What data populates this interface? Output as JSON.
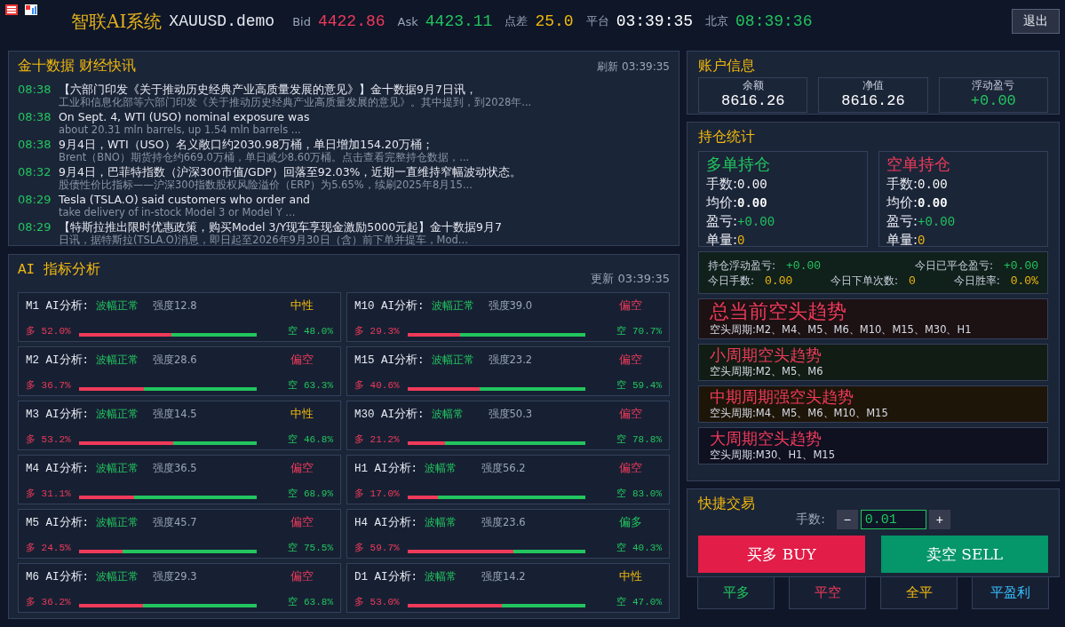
{
  "header": {
    "title": "智联AI系统",
    "symbol": "XAUUSD.demo",
    "quotes": [
      {
        "label": "Bid",
        "value": "4422.86",
        "kind": "red"
      },
      {
        "label": "Ask",
        "value": "4423.11",
        "kind": "green"
      },
      {
        "label": "点差",
        "value": "25.0",
        "kind": "gold"
      },
      {
        "label": "平台",
        "value": "03:39:35",
        "kind": "white"
      },
      {
        "label": "北京",
        "value": "08:39:36",
        "kind": "green"
      }
    ],
    "logout": "退出"
  },
  "news": {
    "title": "金十数据 财经快讯",
    "refreshed": "刷新 03:39:35",
    "items": [
      {
        "time": "08:38",
        "headline": "【六部门印发《关于推动历史经典产业高质量发展的意见》】金十数据9月7日讯，",
        "summary": "工业和信息化部等六部门印发《关于推动历史经典产业高质量发展的意见》。其中提到，到2028年..."
      },
      {
        "time": "08:38",
        "headline": "On Sept. 4, WTI (USO) nominal exposure was",
        "summary": "about 20.31 mln barrels, up 1.54 mln barrels ..."
      },
      {
        "time": "08:38",
        "headline": "9月4日，WTI（USO）名义敞口约2030.98万桶，单日增加154.20万桶；",
        "summary": "Brent（BNO）期货持仓约669.0万桶，单日减少8.60万桶。点击查看完整持仓数据，..."
      },
      {
        "time": "08:32",
        "headline": "9月4日，巴菲特指数（沪深300市值/GDP）回落至92.03%，近期一直维持窄幅波动状态。",
        "summary": "股债性价比指标——沪深300指数股权风险溢价（ERP）为5.65%，续刷2025年8月15..."
      },
      {
        "time": "08:29",
        "headline": "Tesla (TSLA.O) said customers who order and",
        "summary": "take delivery of in-stock Model 3 or Model Y ..."
      },
      {
        "time": "08:29",
        "headline": "【特斯拉推出限时优惠政策，购买Model 3/Y现车享现金激励5000元起】金十数据9月7",
        "summary": "日讯，据特斯拉(TSLA.O)消息，即日起至2026年9月30日（含）前下单并提车，Mod..."
      }
    ]
  },
  "ai": {
    "title": "AI 指标分析",
    "updated": "更新 03:39:35",
    "cards": [
      {
        "label": "M1 AI分析:",
        "volatility": "波幅正常",
        "strength": "强度12.8",
        "bias": "中性",
        "kind": "neutral",
        "long": "多 52.0%",
        "short": "空 48.0%",
        "level": 0.52
      },
      {
        "label": "M10 AI分析:",
        "volatility": "波幅正常",
        "strength": "强度39.0",
        "bias": "偏空",
        "kind": "bear",
        "long": "多 29.3%",
        "short": "空 70.7%",
        "level": 0.293
      },
      {
        "label": "M2 AI分析:",
        "volatility": "波幅正常",
        "strength": "强度28.6",
        "bias": "偏空",
        "kind": "bear",
        "long": "多 36.7%",
        "short": "空 63.3%",
        "level": 0.367
      },
      {
        "label": "M15 AI分析:",
        "volatility": "波幅正常",
        "strength": "强度23.2",
        "bias": "偏空",
        "kind": "bear",
        "long": "多 40.6%",
        "short": "空 59.4%",
        "level": 0.406
      },
      {
        "label": "M3 AI分析:",
        "volatility": "波幅正常",
        "strength": "强度14.5",
        "bias": "中性",
        "kind": "neutral",
        "long": "多 53.2%",
        "short": "空 46.8%",
        "level": 0.532
      },
      {
        "label": "M30 AI分析:",
        "volatility": "波幅常",
        "strength": "强度50.3",
        "bias": "偏空",
        "kind": "bear",
        "long": "多 21.2%",
        "short": "空 78.8%",
        "level": 0.212
      },
      {
        "label": "M4 AI分析:",
        "volatility": "波幅正常",
        "strength": "强度36.5",
        "bias": "偏空",
        "kind": "bear",
        "long": "多 31.1%",
        "short": "空 68.9%",
        "level": 0.311
      },
      {
        "label": "H1 AI分析:",
        "volatility": "波幅常",
        "strength": "强度56.2",
        "bias": "偏空",
        "kind": "bear",
        "long": "多 17.0%",
        "short": "空 83.0%",
        "level": 0.17
      },
      {
        "label": "M5 AI分析:",
        "volatility": "波幅正常",
        "strength": "强度45.7",
        "bias": "偏空",
        "kind": "bear",
        "long": "多 24.5%",
        "short": "空 75.5%",
        "level": 0.245
      },
      {
        "label": "H4 AI分析:",
        "volatility": "波幅常",
        "strength": "强度23.6",
        "bias": "偏多",
        "kind": "bull",
        "long": "多 59.7%",
        "short": "空 40.3%",
        "level": 0.597
      },
      {
        "label": "M6 AI分析:",
        "volatility": "波幅正常",
        "strength": "强度29.3",
        "bias": "偏空",
        "kind": "bear",
        "long": "多 36.2%",
        "short": "空 63.8%",
        "level": 0.362
      },
      {
        "label": "D1 AI分析:",
        "volatility": "波幅常",
        "strength": "强度14.2",
        "bias": "中性",
        "kind": "neutral",
        "long": "多 53.0%",
        "short": "空 47.0%",
        "level": 0.53
      }
    ]
  },
  "account": {
    "title": "账户信息",
    "cards": [
      {
        "label": "余额",
        "value": "8616.26",
        "kind": "white"
      },
      {
        "label": "净值",
        "value": "8616.26",
        "kind": "white"
      },
      {
        "label": "浮动盈亏",
        "value": "+0.00",
        "kind": "green"
      }
    ]
  },
  "positions": {
    "title": "持仓统计",
    "sides": [
      {
        "title": "多单持仓",
        "kind": "green",
        "rows": [
          {
            "label": "手数:",
            "value": "0.00",
            "kind": "white"
          },
          {
            "label": "均价:",
            "value": "0.00",
            "kind": "bold"
          },
          {
            "label": "盈亏:",
            "value": "+0.00",
            "kind": "green"
          },
          {
            "label": "单量:",
            "value": "0",
            "kind": "gold"
          }
        ]
      },
      {
        "title": "空单持仓",
        "kind": "red",
        "rows": [
          {
            "label": "手数:",
            "value": "0.00",
            "kind": "white"
          },
          {
            "label": "均价:",
            "value": "0.00",
            "kind": "bold"
          },
          {
            "label": "盈亏:",
            "value": "+0.00",
            "kind": "green"
          },
          {
            "label": "单量:",
            "value": "0",
            "kind": "gold"
          }
        ]
      }
    ],
    "stats": [
      [
        {
          "label": "持仓浮动盈亏:",
          "value": "+0.00",
          "kind": "green"
        },
        {
          "label": "今日已平仓盈亏:",
          "value": "+0.00",
          "kind": "green"
        }
      ],
      [
        {
          "label": "今日手数:",
          "value": "0.00",
          "kind": "gold"
        },
        {
          "label": "今日下单次数:",
          "value": "0",
          "kind": "gold"
        },
        {
          "label": "今日胜率:",
          "value": "0.0%",
          "kind": "gold"
        }
      ]
    ],
    "trends": [
      {
        "title": "总当前空头趋势",
        "periods": "空头周期:M2、M4、M5、M6、M10、M15、M30、H1",
        "color": "#1c1113",
        "kind": "large"
      },
      {
        "title": "小周期空头趋势",
        "periods": "空头周期:M2、M5、M6",
        "color": "#111c14",
        "kind": "small"
      },
      {
        "title": "中期周期强空头趋势",
        "periods": "空头周期:M4、M5、M6、M10、M15",
        "color": "#1e1509",
        "kind": "small"
      },
      {
        "title": "大周期空头趋势",
        "periods": "空头周期:M30、H1、M15",
        "color": "#0f1020",
        "kind": "small"
      }
    ]
  },
  "trade": {
    "title": "快捷交易",
    "lots_label": "手数:",
    "minus": "−",
    "lots": "0.01",
    "plus": "+",
    "buy": "买多 BUY",
    "sell": "卖空 SELL",
    "actions": [
      {
        "label": "平多",
        "kind": "green"
      },
      {
        "label": "平空",
        "kind": "red"
      },
      {
        "label": "全平",
        "kind": "gold"
      },
      {
        "label": "平盈利",
        "kind": "blue"
      }
    ]
  }
}
